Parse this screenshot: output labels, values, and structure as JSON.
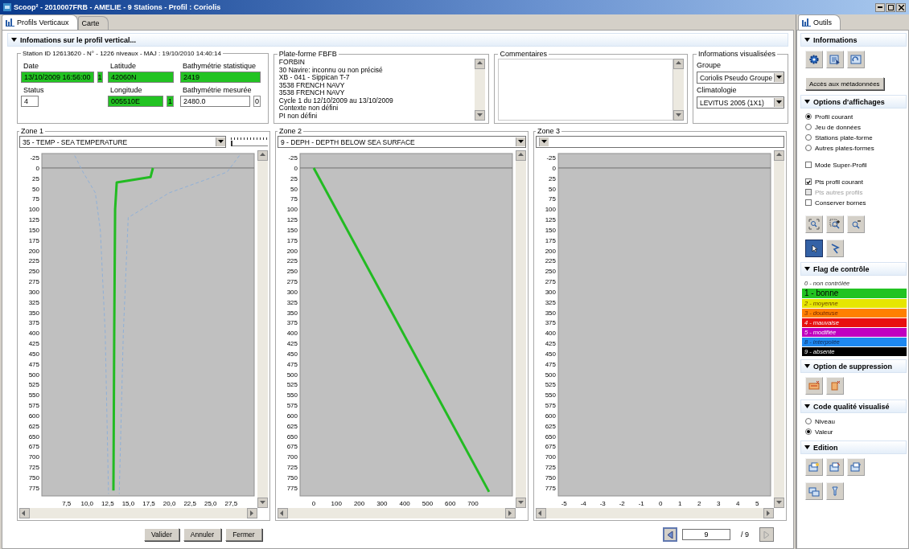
{
  "window": {
    "title": "Scoop² - 2010007FRB - AMELIE - 9 Stations - Profil : Coriolis"
  },
  "tabs": [
    {
      "label": "Profils Verticaux",
      "selected": true
    },
    {
      "label": "Carte",
      "selected": false
    }
  ],
  "info_section": {
    "title": "Infomations sur le profil vertical...",
    "expanded": true,
    "station": {
      "legend": "Station ID 12613620 - N°  - 1226 niveaux - MAJ : 19/10/2010 14:40:14",
      "fields": [
        {
          "label": "Date",
          "value": "13/10/2009 16:56:00",
          "color": "#22c322",
          "flag": "1"
        },
        {
          "label": "Latitude",
          "value": "42060N",
          "color": "#22c322"
        },
        {
          "label": "Bathymétrie statistique",
          "value": "2419",
          "color": "#22c322"
        },
        {
          "label": "Status",
          "value": "4"
        },
        {
          "label": "Longitude",
          "value": "005510E",
          "color": "#22c322",
          "flag": "1"
        },
        {
          "label": "Bathymétrie mesurée",
          "value": "2480.0",
          "flag": "0"
        }
      ]
    },
    "platform": {
      "legend": "Plate-forme FBFB",
      "lines": [
        "FORBIN",
        "30 Navire: inconnu ou non précisé",
        "XB - 041 - Sippican T-7",
        "3538 FRENCH NAVY",
        "3538 FRENCH NAVY",
        "Cycle 1 du 12/10/2009 au 13/10/2009",
        "Contexte non défini",
        "PI non défini"
      ]
    },
    "comments": {
      "legend": "Commentaires"
    },
    "display_info": {
      "legend": "Informations visualisées",
      "group_label": "Groupe",
      "group": "Coriolis Pseudo Groupe",
      "climatology_label": "Climatologie",
      "climatology": "LEVITUS 2005 (1X1)"
    }
  },
  "zones": [
    {
      "legend": "Zone 1",
      "parameter": "35 - TEMP - SEA TEMPERATURE",
      "slider": {
        "level": 0
      },
      "chart_data": {
        "type": "line",
        "xlim": [
          4.5,
          30.3
        ],
        "ylim": [
          795,
          -35
        ],
        "xticks": [
          {
            "value": 7.5,
            "label": "7,5"
          },
          {
            "value": 10,
            "label": "10,0"
          },
          {
            "value": 12.5,
            "label": "12,5"
          },
          {
            "value": 15,
            "label": "15,0"
          },
          {
            "value": 17.5,
            "label": "17,5"
          },
          {
            "value": 20,
            "label": "20,0"
          },
          {
            "value": 22.5,
            "label": "22,5"
          },
          {
            "value": 25,
            "label": "25,0"
          },
          {
            "value": 27.5,
            "label": "27,5"
          }
        ],
        "yticks": [
          -25,
          0,
          25,
          50,
          75,
          100,
          125,
          150,
          175,
          200,
          225,
          250,
          275,
          300,
          325,
          350,
          375,
          400,
          425,
          450,
          475,
          500,
          525,
          550,
          575,
          600,
          625,
          650,
          675,
          700,
          725,
          750,
          775
        ],
        "x": [
          18,
          17.7,
          13.6,
          13.4,
          13.3,
          13.2
        ],
        "series": [
          {
            "color": "#22bb22",
            "values": [
              0,
              22,
              35,
              100,
              400,
              782
            ]
          },
          {
            "color": "#8fb0d8",
            "line_style": "dashed",
            "x": [
              8.5,
              9.5,
              11,
              11.6,
              12.2,
              12.6
            ],
            "values": [
              -30,
              10,
              60,
              150,
              400,
              790
            ]
          },
          {
            "color": "#8fb0d8",
            "line_style": "dashed",
            "x": [
              28.5,
              27,
              20,
              15,
              14.4,
              13.9
            ],
            "values": [
              -30,
              10,
              60,
              120,
              400,
              790
            ]
          }
        ]
      }
    },
    {
      "legend": "Zone 2",
      "parameter": "9 - DEPH - DEPTH BELOW SEA SURFACE",
      "chart_data": {
        "type": "line",
        "xlim": [
          -60,
          873
        ],
        "ylim": [
          795,
          -35
        ],
        "xticks": [
          0,
          100,
          200,
          300,
          400,
          500,
          600,
          700
        ],
        "yticks": [
          -25,
          0,
          25,
          50,
          75,
          100,
          125,
          150,
          175,
          200,
          225,
          250,
          275,
          300,
          325,
          350,
          375,
          400,
          425,
          450,
          475,
          500,
          525,
          550,
          575,
          600,
          625,
          650,
          675,
          700,
          725,
          750,
          775
        ],
        "x": [
          0,
          770
        ],
        "series": [
          {
            "color": "#22bb22",
            "values": [
              0,
              785
            ]
          }
        ]
      }
    },
    {
      "legend": "Zone 3",
      "chart_data": {
        "type": "line",
        "xlim": [
          -5.3,
          5.7
        ],
        "ylim": [
          795,
          -35
        ],
        "xticks": [
          -5,
          -4,
          -3,
          -2,
          -1,
          0,
          1,
          2,
          3,
          4,
          5
        ],
        "yticks": [
          -25,
          0,
          25,
          50,
          75,
          100,
          125,
          150,
          175,
          200,
          225,
          250,
          275,
          300,
          325,
          350,
          375,
          400,
          425,
          450,
          475,
          500,
          525,
          550,
          575,
          600,
          625,
          650,
          675,
          700,
          725,
          750,
          775
        ]
      }
    }
  ],
  "footer": {
    "buttons": [
      "Valider",
      "Annuler",
      "Fermer"
    ],
    "pager": {
      "value": "9",
      "total": "/ 9",
      "prev_disabled": false,
      "next_disabled": true
    }
  },
  "tools_panel": {
    "tab": {
      "label": "Outils",
      "selected": true
    },
    "sections": [
      {
        "kind": "info",
        "title": "Informations",
        "expanded": true,
        "button": "Accès aux métadonnées"
      },
      {
        "kind": "options",
        "title": "Options d'affichages",
        "expanded": true,
        "radios": [
          {
            "label": "Profil courant",
            "selected": true
          },
          {
            "label": "Jeu de données",
            "selected": false
          },
          {
            "label": "Stations plate-forme",
            "selected": false
          },
          {
            "label": "Autres plates-formes",
            "selected": false
          }
        ],
        "checkboxes": [
          {
            "label": "Mode Super-Profil",
            "checked": false,
            "disabled": false
          },
          {
            "label": "Pts profil courant",
            "checked": true,
            "disabled": false
          },
          {
            "label": "Pts autres profils",
            "checked": false,
            "disabled": true
          },
          {
            "label": "Conserver bornes",
            "checked": false,
            "disabled": false
          }
        ],
        "tools": [
          {
            "selected": false
          },
          {
            "selected": false
          },
          {
            "selected": false
          },
          {
            "selected": true
          },
          {
            "selected": false
          }
        ]
      },
      {
        "kind": "flags",
        "title": "Flag de contrôle",
        "expanded": true,
        "flags": [
          {
            "label": "0 - non contrôlée",
            "selected": false
          },
          {
            "label": "1 - bonne",
            "color": "#22c322",
            "selected": true
          },
          {
            "label": "2 - moyenne",
            "color": "#e6e600",
            "selected": false
          },
          {
            "label": "3 - douteuse",
            "color": "#ff8000",
            "selected": false
          },
          {
            "label": "4 - mauvaise",
            "color": "#e81010",
            "selected": false
          },
          {
            "label": "5 - modifiée",
            "color": "#c000c0",
            "selected": false
          },
          {
            "label": "8 - interpolée",
            "color": "#1e88f0",
            "selected": false
          },
          {
            "label": "9 - absente",
            "color": "#000000",
            "selected": false
          }
        ]
      },
      {
        "kind": "delete",
        "title": "Option de suppression",
        "expanded": true
      },
      {
        "kind": "quality",
        "title": "Code qualité visualisé",
        "expanded": true,
        "radios": [
          {
            "label": "Niveau",
            "selected": false
          },
          {
            "label": "Valeur",
            "selected": true
          }
        ]
      },
      {
        "kind": "edit",
        "title": "Edition",
        "expanded": true
      }
    ]
  }
}
